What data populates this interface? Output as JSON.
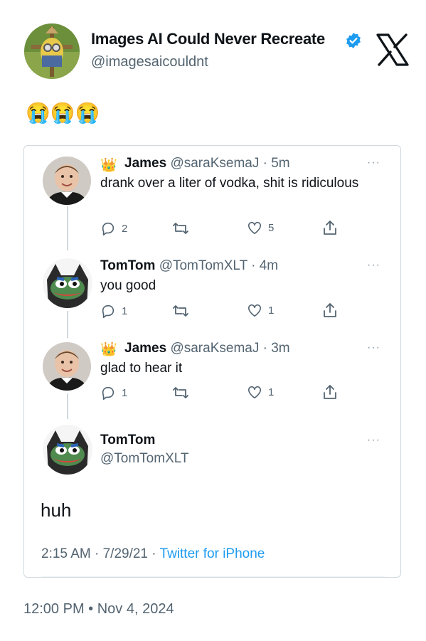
{
  "header": {
    "display_name": "Images AI Could Never Recreate",
    "handle": "@imagesaicouldnt"
  },
  "body_text": "😭😭😭",
  "quoted_thread": {
    "tweets": [
      {
        "name": "James",
        "handle_time": "@saraKsemaJ · 5m",
        "text": "drank over a liter of vodka, shit is ridiculous",
        "replies": "2",
        "retweets": "",
        "likes": "5"
      },
      {
        "name": "TomTom",
        "handle_time": "@TomTomXLT · 4m",
        "text": "you good",
        "replies": "1",
        "retweets": "",
        "likes": "1"
      },
      {
        "name": "James",
        "handle_time": "@saraKsemaJ · 3m",
        "text": "glad to hear it",
        "replies": "1",
        "retweets": "",
        "likes": "1"
      }
    ],
    "main": {
      "name": "TomTom",
      "handle": "@TomTomXLT",
      "text": "huh",
      "time": "2:15 AM · 7/29/21 · ",
      "source": "Twitter for iPhone"
    },
    "more_label": "···"
  },
  "footer": {
    "timestamp": "12:00 PM • Nov 4, 2024"
  },
  "colors": {
    "accent": "#1d9bf0",
    "secondary_text": "#536471",
    "border": "#cfd9de"
  }
}
